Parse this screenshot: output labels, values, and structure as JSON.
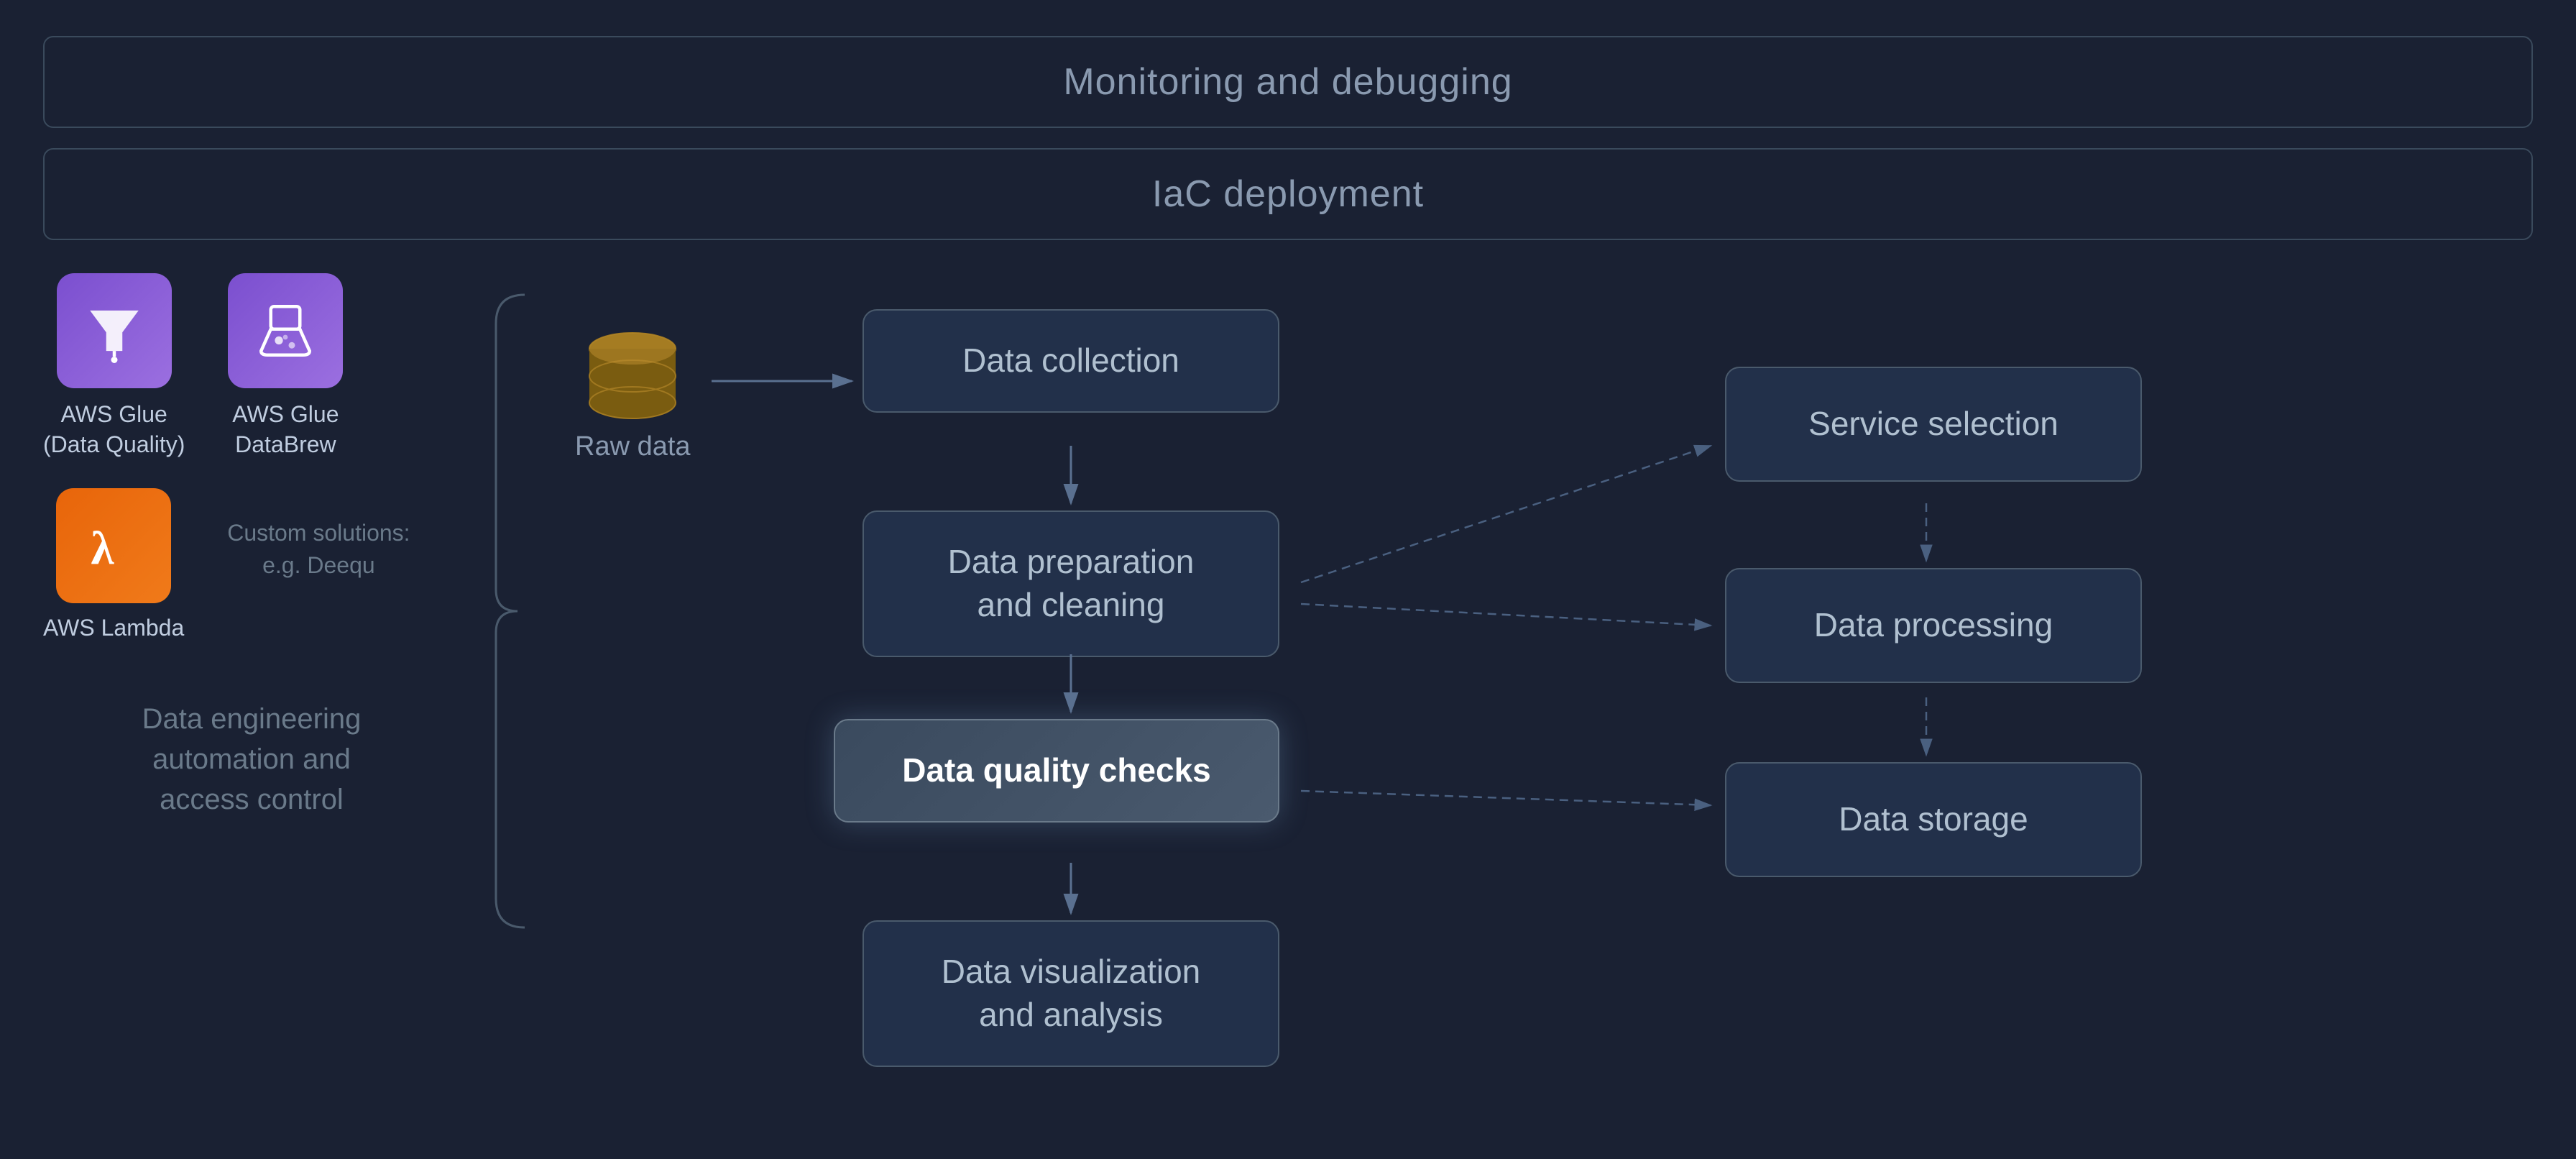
{
  "banners": {
    "monitoring": "Monitoring and debugging",
    "iac": "IaC deployment"
  },
  "services": [
    {
      "id": "glue-quality",
      "label": "AWS Glue\n(Data Quality)",
      "icon_type": "purple",
      "icon": "funnel"
    },
    {
      "id": "glue-databrew",
      "label": "AWS Glue\nDataBrew",
      "icon_type": "purple",
      "icon": "databrew"
    },
    {
      "id": "lambda",
      "label": "AWS Lambda",
      "icon_type": "orange",
      "icon": "lambda"
    },
    {
      "id": "custom",
      "label": "Custom solutions:\ne.g. Deequ",
      "icon_type": "none",
      "icon": ""
    }
  ],
  "automation_label": "Data engineering\nautomation and\naccess control",
  "raw_data_label": "Raw data",
  "pipeline": [
    {
      "id": "data-collection",
      "label": "Data collection",
      "highlighted": false
    },
    {
      "id": "data-preparation",
      "label": "Data preparation\nand cleaning",
      "highlighted": false
    },
    {
      "id": "data-quality",
      "label": "Data quality\nchecks",
      "highlighted": true
    },
    {
      "id": "data-visualization",
      "label": "Data visualization\nand analysis",
      "highlighted": false
    }
  ],
  "right_panel": [
    {
      "id": "service-selection",
      "label": "Service selection"
    },
    {
      "id": "data-processing",
      "label": "Data processing"
    },
    {
      "id": "data-storage",
      "label": "Data storage"
    }
  ]
}
